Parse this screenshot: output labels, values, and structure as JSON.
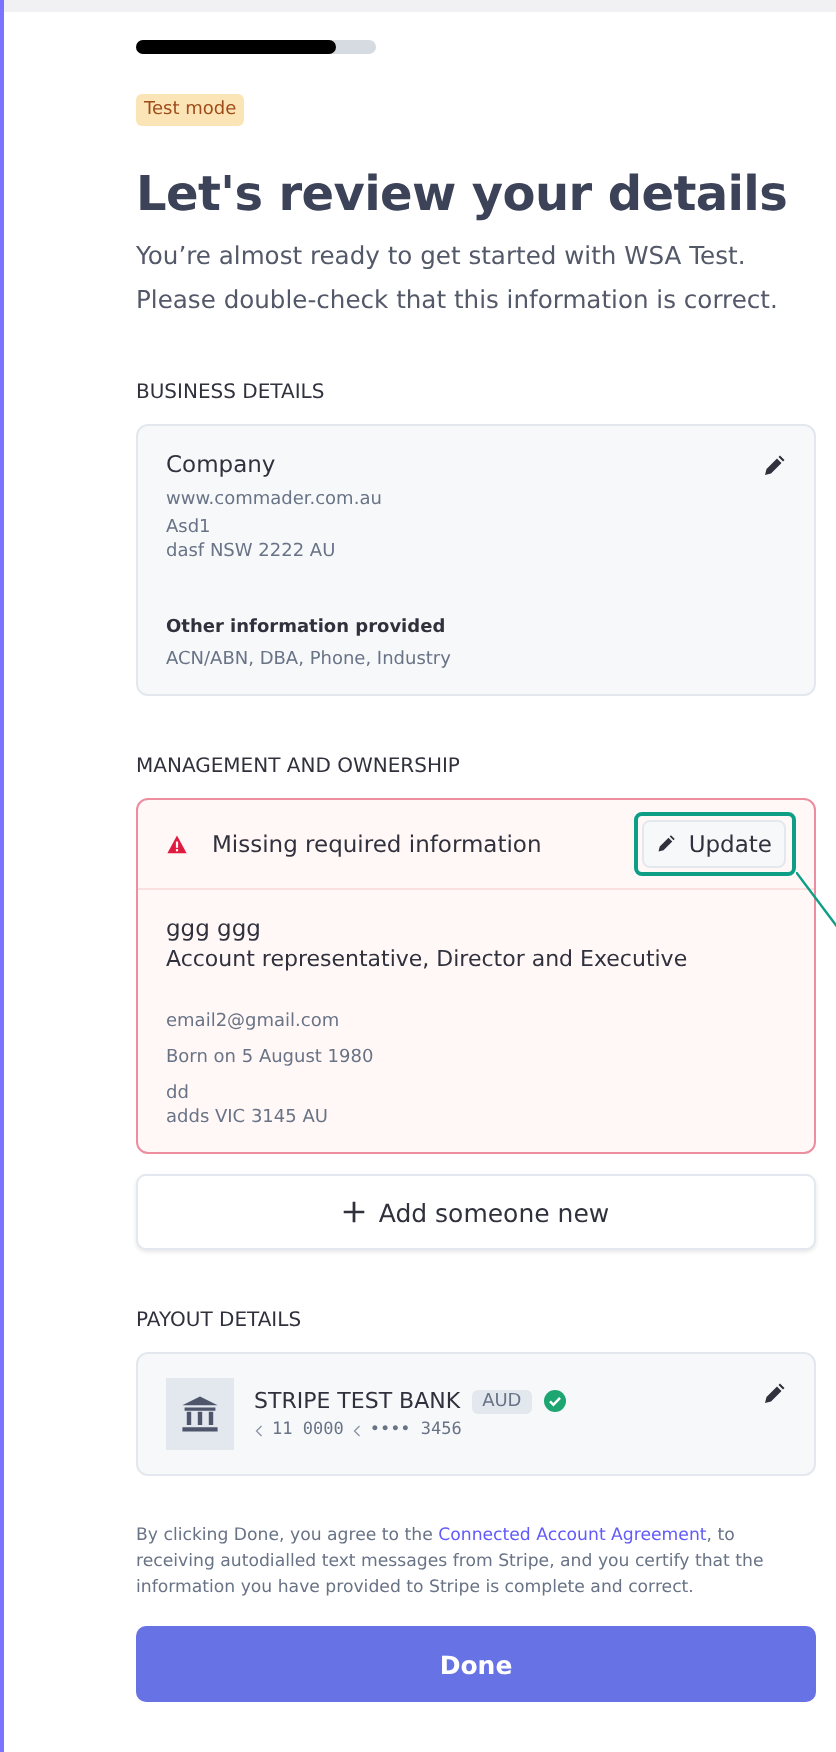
{
  "progress": {
    "level": 0.83
  },
  "badge": "Test mode",
  "title": "Let's review your details",
  "subtitle": "You’re almost ready to get started with WSA Test. Please double-check that this information is correct.",
  "business": {
    "heading": "BUSINESS DETAILS",
    "name": "Company",
    "website": "www.commader.com.au",
    "address": [
      "Asd1",
      "dasf NSW 2222 AU"
    ],
    "other_label": "Other information provided",
    "other_value": "ACN/ABN, DBA, Phone, Industry"
  },
  "management": {
    "heading": "MANAGEMENT AND OWNERSHIP",
    "alert": "Missing required information",
    "update_button": "Update",
    "highlighted": true,
    "person": {
      "name": "ggg ggg",
      "roles": "Account representative, Director and Executive",
      "email": "email2@gmail.com",
      "born": "Born on 5 August 1980",
      "address": [
        "dd",
        "adds VIC 3145 AU"
      ]
    },
    "add_button": "Add someone new"
  },
  "payout": {
    "heading": "PAYOUT DETAILS",
    "bank": "STRIPE TEST BANK",
    "currency": "AUD",
    "verified": true,
    "routing": "11 0000",
    "account": "•••• 3456"
  },
  "legal": {
    "before": "By clicking Done, you agree to the ",
    "link": "Connected Account Agreement",
    "after": ", to receiving autodialled text messages from Stripe, and you certify that the information you have provided to Stripe is complete and correct."
  },
  "done_button": "Done"
}
